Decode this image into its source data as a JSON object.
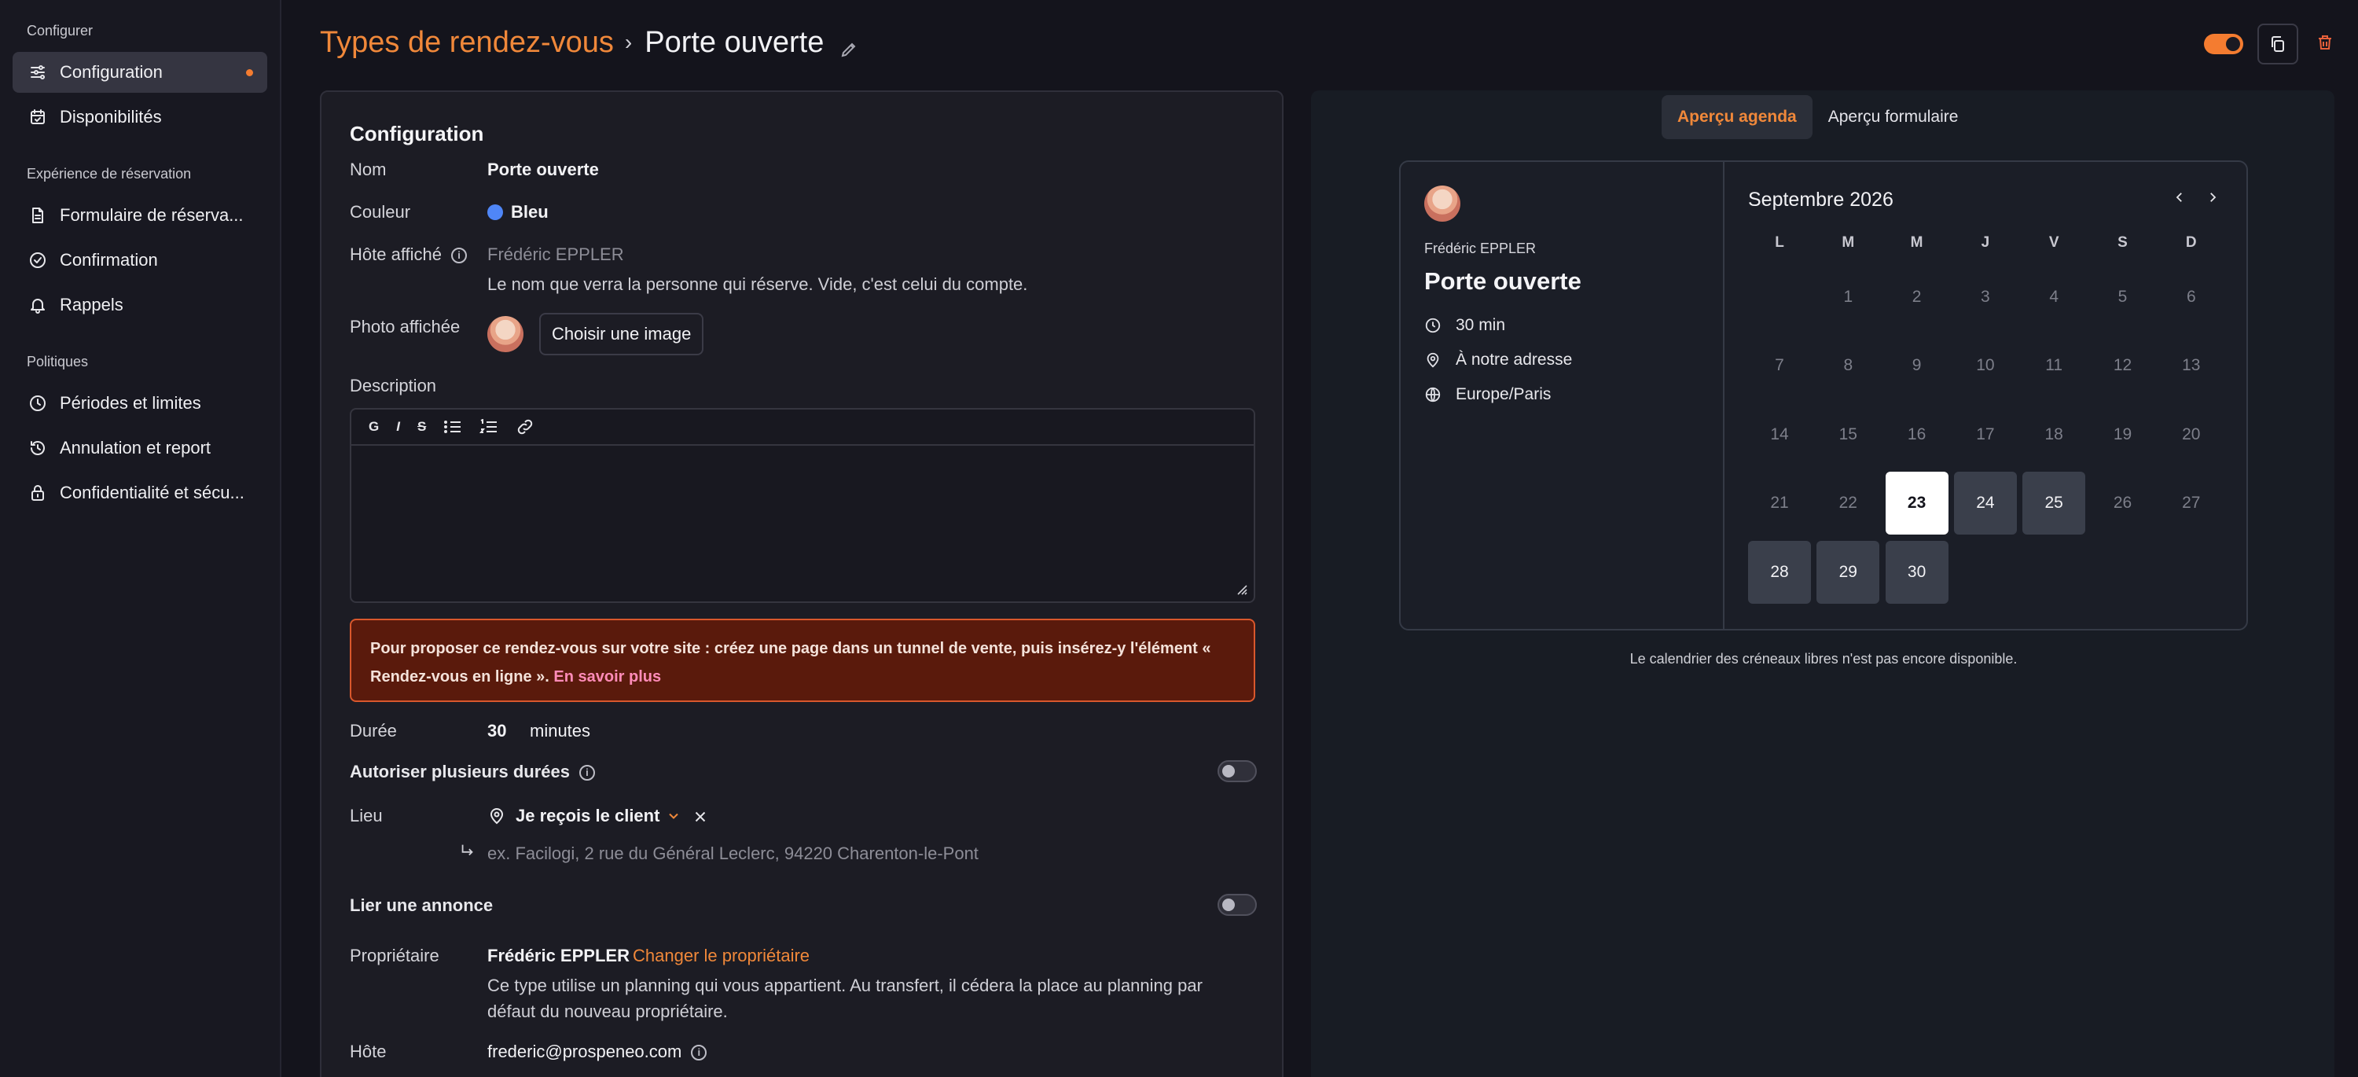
{
  "sidebar": {
    "sections": [
      {
        "title": "Configurer"
      },
      {
        "title": "Expérience de réservation"
      },
      {
        "title": "Politiques"
      }
    ],
    "items": [
      {
        "label": "Configuration",
        "icon": "sliders-icon",
        "active": true
      },
      {
        "label": "Disponibilités",
        "icon": "calendar-icon"
      },
      {
        "label": "Formulaire de réserva...",
        "icon": "document-icon"
      },
      {
        "label": "Confirmation",
        "icon": "check-circle-icon"
      },
      {
        "label": "Rappels",
        "icon": "bell-icon"
      },
      {
        "label": "Périodes et limites",
        "icon": "clock-icon"
      },
      {
        "label": "Annulation et report",
        "icon": "history-icon"
      },
      {
        "label": "Confidentialité et sécu...",
        "icon": "lock-icon"
      }
    ]
  },
  "header": {
    "breadcrumb_parent": "Types de rendez-vous",
    "separator": "›",
    "title": "Porte ouverte"
  },
  "config": {
    "title": "Configuration",
    "name_label": "Nom",
    "name_value": "Porte ouverte",
    "color_label": "Couleur",
    "color_value": "Bleu",
    "color_hex": "#4f86f7",
    "host_label": "Hôte affiché",
    "host_placeholder": "Frédéric EPPLER",
    "host_help": "Le nom que verra la personne qui réserve. Vide, c'est celui du compte.",
    "photo_label": "Photo affichée",
    "photo_button": "Choisir une image",
    "description_label": "Description",
    "toolbar": {
      "bold": "G",
      "italic": "I",
      "strike": "S"
    },
    "alert_text": "Pour proposer ce rendez-vous sur votre site : créez une page dans un tunnel de vente, puis insérez-y l'élément « Rendez-vous en ligne ».",
    "alert_link": "En savoir plus",
    "duration_label": "Durée",
    "duration_value": "30",
    "duration_unit": "minutes",
    "multi_duration_label": "Autoriser plusieurs durées",
    "multi_duration_enabled": false,
    "location_label": "Lieu",
    "location_value": "Je reçois le client",
    "address_placeholder": "ex. Facilogi, 2 rue du Général Leclerc, 94220 Charenton-le-Pont",
    "link_ad_label": "Lier une annonce",
    "link_ad_enabled": false,
    "owner_label": "Propriétaire",
    "owner_value": "Frédéric EPPLER",
    "owner_change": "Changer le propriétaire",
    "owner_help_1": "Ce type utilise un planning qui vous appartient. Au transfert, il cédera la place au planning par",
    "owner_help_2": "défaut du nouveau propriétaire.",
    "host_email_label": "Hôte",
    "host_email_value": "frederic@prospeneo.com"
  },
  "preview": {
    "tabs": [
      {
        "label": "Aperçu agenda",
        "active": true
      },
      {
        "label": "Aperçu formulaire",
        "active": false
      }
    ],
    "host_name": "Frédéric EPPLER",
    "event_title": "Porte ouverte",
    "duration": "30 min",
    "location": "À notre adresse",
    "timezone": "Europe/Paris",
    "month": "Septembre 2026",
    "weekdays": [
      "L",
      "M",
      "M",
      "J",
      "V",
      "S",
      "D"
    ],
    "days": [
      {
        "n": "1",
        "col": 1,
        "row": 0
      },
      {
        "n": "2",
        "col": 2,
        "row": 0
      },
      {
        "n": "3",
        "col": 3,
        "row": 0
      },
      {
        "n": "4",
        "col": 4,
        "row": 0
      },
      {
        "n": "5",
        "col": 5,
        "row": 0
      },
      {
        "n": "6",
        "col": 6,
        "row": 0
      },
      {
        "n": "7",
        "col": 0,
        "row": 1
      },
      {
        "n": "8",
        "col": 1,
        "row": 1
      },
      {
        "n": "9",
        "col": 2,
        "row": 1
      },
      {
        "n": "10",
        "col": 3,
        "row": 1
      },
      {
        "n": "11",
        "col": 4,
        "row": 1
      },
      {
        "n": "12",
        "col": 5,
        "row": 1
      },
      {
        "n": "13",
        "col": 6,
        "row": 1
      },
      {
        "n": "14",
        "col": 0,
        "row": 2
      },
      {
        "n": "15",
        "col": 1,
        "row": 2
      },
      {
        "n": "16",
        "col": 2,
        "row": 2
      },
      {
        "n": "17",
        "col": 3,
        "row": 2
      },
      {
        "n": "18",
        "col": 4,
        "row": 2
      },
      {
        "n": "19",
        "col": 5,
        "row": 2
      },
      {
        "n": "20",
        "col": 6,
        "row": 2
      },
      {
        "n": "21",
        "col": 0,
        "row": 3
      },
      {
        "n": "22",
        "col": 1,
        "row": 3
      },
      {
        "n": "23",
        "col": 2,
        "row": 3,
        "state": "selected"
      },
      {
        "n": "24",
        "col": 3,
        "row": 3,
        "state": "available"
      },
      {
        "n": "25",
        "col": 4,
        "row": 3,
        "state": "available"
      },
      {
        "n": "26",
        "col": 5,
        "row": 3
      },
      {
        "n": "27",
        "col": 6,
        "row": 3
      },
      {
        "n": "28",
        "col": 0,
        "row": 4,
        "state": "available"
      },
      {
        "n": "29",
        "col": 1,
        "row": 4,
        "state": "available"
      },
      {
        "n": "30",
        "col": 2,
        "row": 4,
        "state": "available"
      }
    ],
    "note": "Le calendrier des créneaux libres n'est pas encore disponible."
  },
  "colors": {
    "accent": "#f47c30",
    "link": "#f0883a",
    "alert_bg": "#5a1a0c",
    "alert_border": "#d9572c"
  }
}
